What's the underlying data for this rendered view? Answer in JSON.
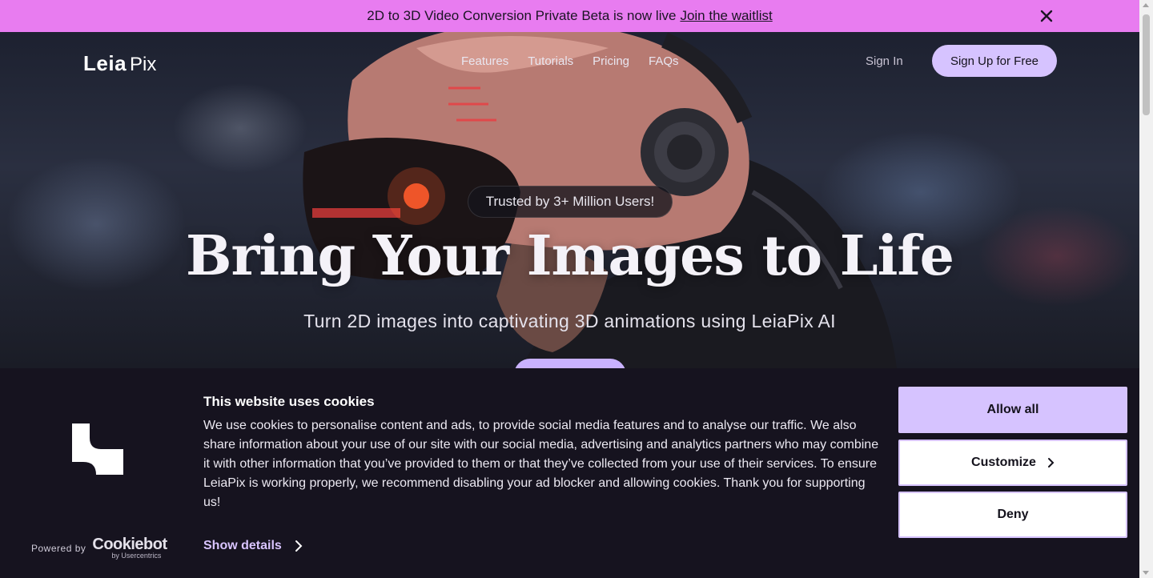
{
  "announcement": {
    "text": "2D to 3D Video Conversion Private Beta is now live",
    "link": "Join the waitlist",
    "close_icon": "close-icon"
  },
  "header": {
    "logo_leia": "Leia",
    "logo_pix": "Pix",
    "nav": [
      {
        "label": "Features"
      },
      {
        "label": "Tutorials"
      },
      {
        "label": "Pricing"
      },
      {
        "label": "FAQs"
      }
    ],
    "signin": "Sign In",
    "signup": "Sign Up for Free"
  },
  "hero": {
    "trusted": "Trusted by 3+ Million Users!",
    "headline": "Bring Your Images to Life",
    "subline": "Turn 2D images into captivating 3D animations using LeiaPix AI"
  },
  "cookie": {
    "title": "This website uses cookies",
    "text": "We use cookies to personalise content and ads, to provide social media features and to analyse our traffic. We also share information about your use of our site with our social media, advertising and analytics partners who may combine it with other information that you’ve provided to them or that they’ve collected from your use of their services. To ensure LeiaPix is working properly, we recommend disabling your ad blocker and allowing cookies. Thank you for supporting us!",
    "show_details": "Show details",
    "allow_all": "Allow all",
    "customize": "Customize",
    "deny": "Deny",
    "powered_by": "Powered by",
    "brand": "Cookiebot",
    "brand_sub": "by Usercentrics"
  },
  "colors": {
    "announcement_bg": "#e87cf0",
    "accent": "#d6c3ff",
    "banner_bg": "#16131f"
  }
}
